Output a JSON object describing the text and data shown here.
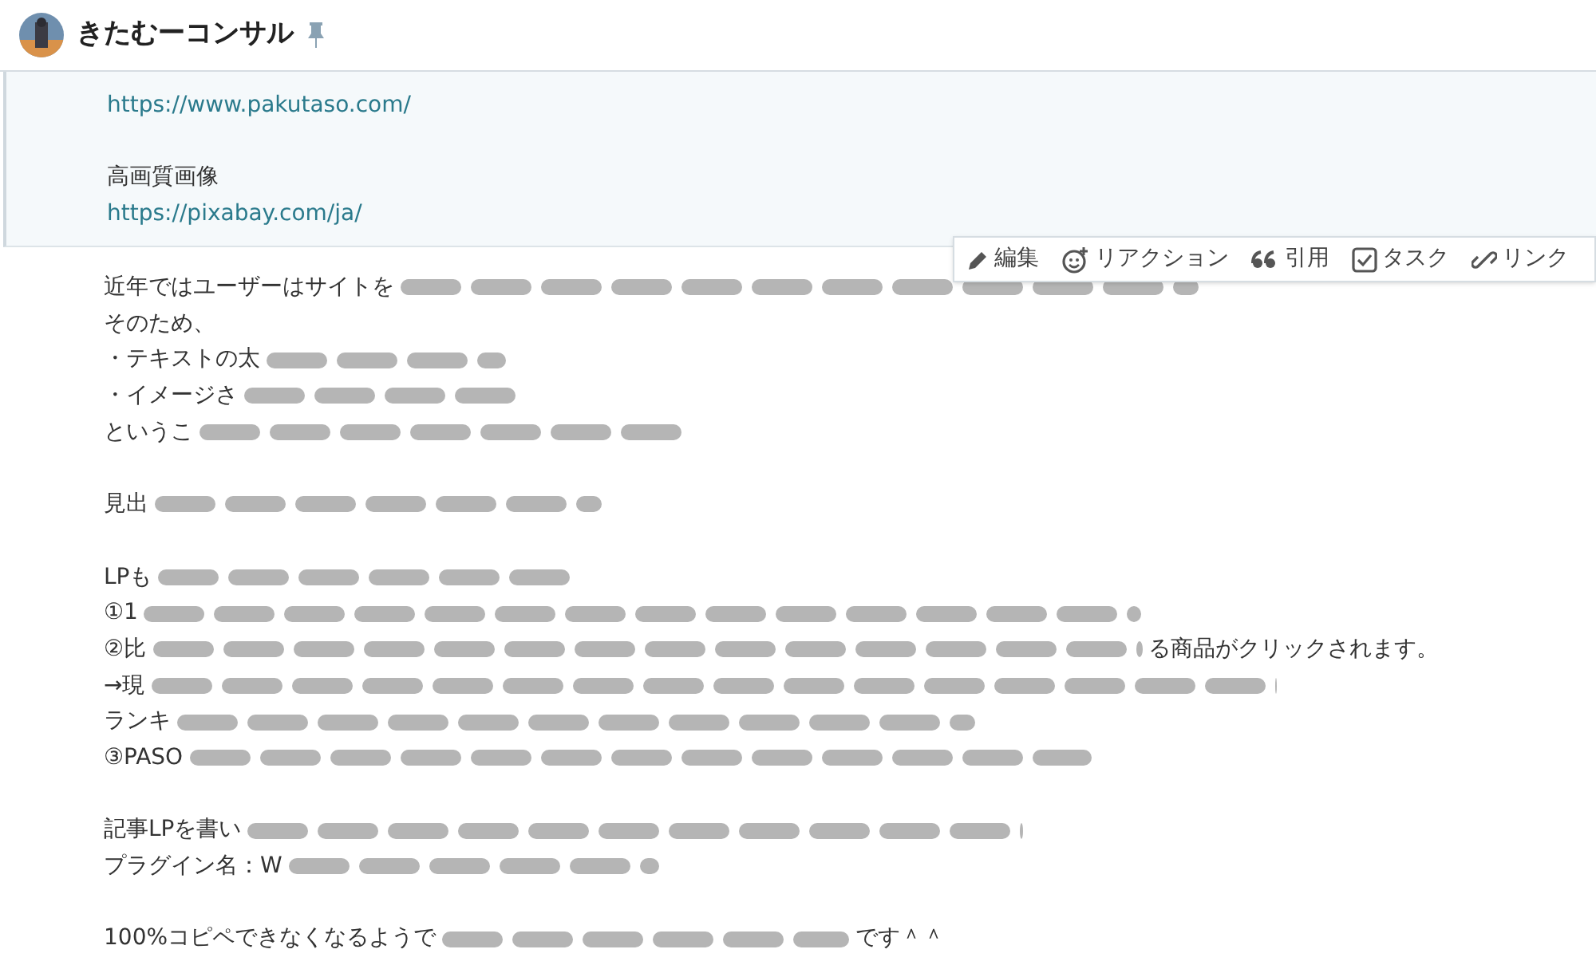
{
  "header": {
    "title": "きたむーコンサル",
    "pinned": true
  },
  "pinned_message": {
    "lines": [
      {
        "kind": "link",
        "text": "https://www.pakutaso.com/"
      },
      {
        "kind": "blank"
      },
      {
        "kind": "text",
        "text": "高画質画像"
      },
      {
        "kind": "link",
        "text": "https://pixabay.com/ja/"
      }
    ]
  },
  "message_actions": [
    {
      "kind": "edit",
      "label": "編集"
    },
    {
      "kind": "reaction",
      "label": "リアクション"
    },
    {
      "kind": "quote",
      "label": "引用"
    },
    {
      "kind": "task",
      "label": "タスク"
    },
    {
      "kind": "link",
      "label": "リンク"
    }
  ],
  "message": {
    "lines": [
      {
        "kind": "text",
        "segments": [
          {
            "kind": "text",
            "text": "近年ではユーザーはサイトを"
          },
          {
            "kind": "blurred"
          }
        ]
      },
      {
        "kind": "text",
        "segments": [
          {
            "kind": "text",
            "text": "そのため、"
          }
        ]
      },
      {
        "kind": "text",
        "segments": [
          {
            "kind": "text",
            "text": "・テキストの太"
          },
          {
            "kind": "blurred"
          }
        ]
      },
      {
        "kind": "text",
        "segments": [
          {
            "kind": "text",
            "text": "・イメージさ"
          },
          {
            "kind": "blurred"
          }
        ]
      },
      {
        "kind": "text",
        "segments": [
          {
            "kind": "text",
            "text": "というこ"
          },
          {
            "kind": "blurred"
          }
        ]
      },
      {
        "kind": "blank"
      },
      {
        "kind": "text",
        "segments": [
          {
            "kind": "text",
            "text": "見出"
          },
          {
            "kind": "blurred"
          }
        ]
      },
      {
        "kind": "blank"
      },
      {
        "kind": "text",
        "segments": [
          {
            "kind": "text",
            "text": "LPも"
          },
          {
            "kind": "blurred"
          }
        ]
      },
      {
        "kind": "text",
        "segments": [
          {
            "kind": "text",
            "text": "①1"
          },
          {
            "kind": "blurred"
          }
        ]
      },
      {
        "kind": "text",
        "segments": [
          {
            "kind": "text",
            "text": "②比"
          },
          {
            "kind": "blurred"
          },
          {
            "kind": "text",
            "text": "る商品がクリックされます。"
          }
        ]
      },
      {
        "kind": "text",
        "segments": [
          {
            "kind": "text",
            "text": "→現"
          },
          {
            "kind": "blurred"
          }
        ]
      },
      {
        "kind": "text",
        "segments": [
          {
            "kind": "text",
            "text": "ランキ"
          },
          {
            "kind": "blurred"
          }
        ]
      },
      {
        "kind": "text",
        "segments": [
          {
            "kind": "text",
            "text": "③PASO"
          },
          {
            "kind": "blurred"
          }
        ]
      },
      {
        "kind": "blank"
      },
      {
        "kind": "text",
        "segments": [
          {
            "kind": "text",
            "text": "記事LPを書い"
          },
          {
            "kind": "blurred"
          }
        ]
      },
      {
        "kind": "text",
        "segments": [
          {
            "kind": "text",
            "text": "プラグイン名：W"
          },
          {
            "kind": "blurred"
          }
        ]
      },
      {
        "kind": "blank"
      },
      {
        "kind": "text",
        "segments": [
          {
            "kind": "text",
            "text": "100%コピペできなくなるようで"
          },
          {
            "kind": "blurred"
          },
          {
            "kind": "text",
            "text": "です＾＾"
          }
        ]
      }
    ]
  }
}
